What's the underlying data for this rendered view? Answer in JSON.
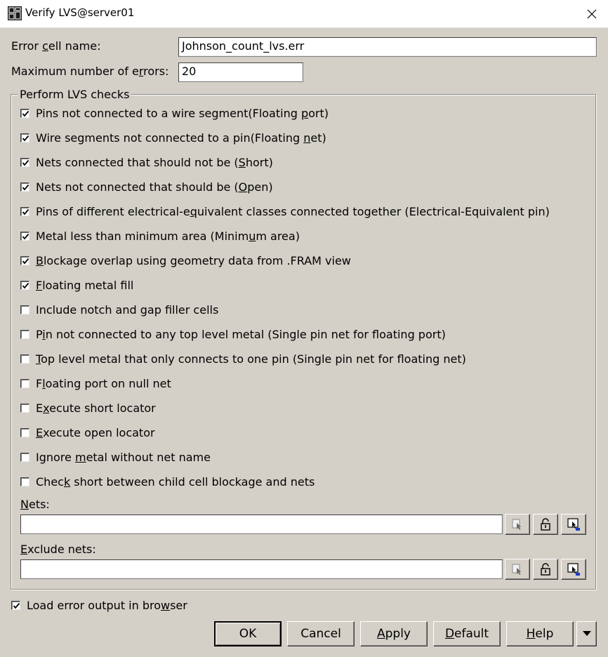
{
  "window": {
    "title": "Verify LVS@server01",
    "app_icon": "layout-grid-icon",
    "close_icon": "close-icon"
  },
  "fields": {
    "error_cell_pre": "Error ",
    "error_cell_u": "c",
    "error_cell_post": "ell name:",
    "error_cell_value": "Johnson_count_lvs.err",
    "max_errors_pre": "Maximum number of e",
    "max_errors_u": "r",
    "max_errors_post": "rors:",
    "max_errors_value": "20"
  },
  "group": {
    "title": "Perform LVS checks"
  },
  "checks": [
    {
      "pre": "Pins not connected to a wire segment(Floating ",
      "u": "p",
      "post": "ort)",
      "checked": true
    },
    {
      "pre": "Wire segments not connected to a pin(Floating ",
      "u": "n",
      "post": "et)",
      "checked": true
    },
    {
      "pre": "Nets connected that should not be (",
      "u": "S",
      "post": "hort)",
      "checked": true
    },
    {
      "pre": "Nets not connected that should be (",
      "u": "O",
      "post": "pen)",
      "checked": true
    },
    {
      "pre": "Pins of different electrical-e",
      "u": "q",
      "post": "uivalent classes connected together (Electrical-Equivalent pin)",
      "checked": true
    },
    {
      "pre": "Metal less than minimum area (Minim",
      "u": "u",
      "post": "m area)",
      "checked": true
    },
    {
      "pre": "",
      "u": "B",
      "post": "lockage overlap using geometry data from .FRAM view",
      "checked": true
    },
    {
      "pre": "",
      "u": "F",
      "post": "loating metal fill",
      "checked": true
    },
    {
      "pre": "Include notch and ",
      "u": "g",
      "post": "ap filler cells",
      "checked": false
    },
    {
      "pre": "P",
      "u": "i",
      "post": "n not connected to any top level metal (Single pin net for floating port)",
      "checked": false
    },
    {
      "pre": "",
      "u": "T",
      "post": "op level metal that only connects to one pin (Single pin net for floating net)",
      "checked": false
    },
    {
      "pre": "F",
      "u": "l",
      "post": "oating port on null net",
      "checked": false
    },
    {
      "pre": "E",
      "u": "x",
      "post": "ecute short locator",
      "checked": false
    },
    {
      "pre": "",
      "u": "E",
      "post": "xecute open locator",
      "checked": false
    },
    {
      "pre": "Ignore ",
      "u": "m",
      "post": "etal without net name",
      "checked": false
    },
    {
      "pre": "Chec",
      "u": "k",
      "post": " short between child cell blockage and nets",
      "checked": false
    }
  ],
  "nets": {
    "label_u": "N",
    "label_post": "ets:",
    "value": "",
    "icons": [
      "select-pointer-icon",
      "unlock-icon",
      "select-from-view-icon"
    ]
  },
  "exclude_nets": {
    "label_u": "E",
    "label_post": "xclude nets:",
    "value": "",
    "icons": [
      "select-pointer-icon",
      "unlock-icon",
      "select-from-view-icon"
    ]
  },
  "load_output": {
    "pre": "Load error output in bro",
    "u": "w",
    "post": "ser",
    "checked": true
  },
  "buttons": {
    "ok": "OK",
    "cancel": "Cancel",
    "apply_u": "A",
    "apply_post": "pply",
    "default_u": "D",
    "default_post": "efault",
    "help_u": "H",
    "help_post": "elp",
    "more_icon": "dropdown-arrow-icon"
  }
}
